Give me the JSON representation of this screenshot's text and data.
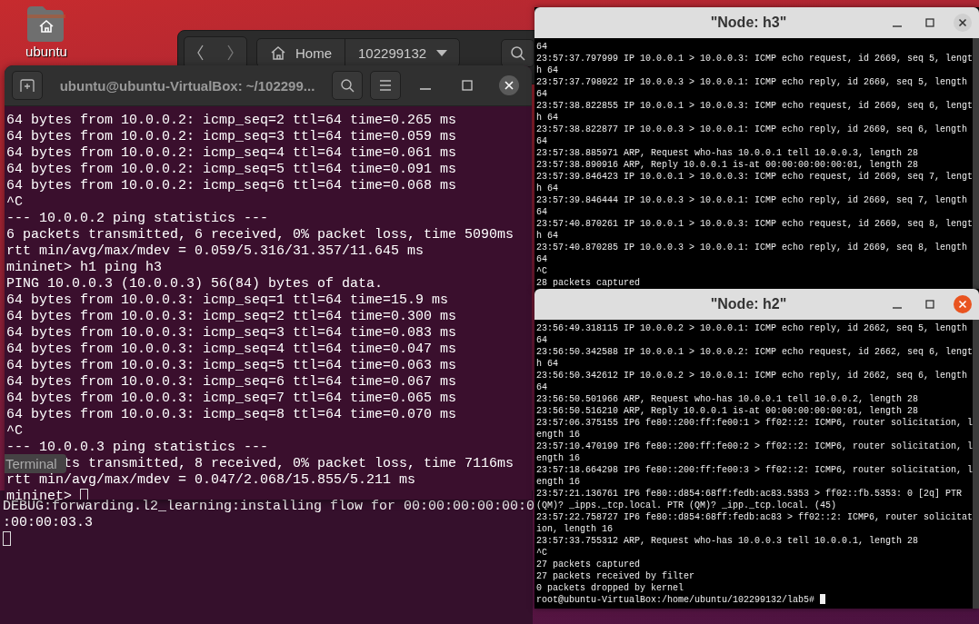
{
  "desktop": {
    "icons": [
      {
        "label": "ubuntu"
      }
    ]
  },
  "file_manager": {
    "path": [
      {
        "label": "Home",
        "kind": "home"
      },
      {
        "label": "102299132",
        "kind": "current"
      }
    ]
  },
  "terminal": {
    "title": "ubuntu@ubuntu-VirtualBox: ~/102299...",
    "lines": [
      {
        "text": "64 bytes from 10.0.0.2: icmp_seq=2 ttl=64 time=0.265 ms"
      },
      {
        "text": "64 bytes from 10.0.0.2: icmp_seq=3 ttl=64 time=0.059 ms"
      },
      {
        "text": "64 bytes from 10.0.0.2: icmp_seq=4 ttl=64 time=0.061 ms"
      },
      {
        "text": "64 bytes from 10.0.0.2: icmp_seq=5 ttl=64 time=0.091 ms"
      },
      {
        "text": "64 bytes from 10.0.0.2: icmp_seq=6 ttl=64 time=0.068 ms"
      },
      {
        "text": "^C"
      },
      {
        "text": "--- 10.0.0.2 ping statistics ---"
      },
      {
        "text": "6 packets transmitted, 6 received, 0% packet loss, time 5090ms"
      },
      {
        "text": "rtt min/avg/max/mdev = 0.059/5.316/31.357/11.645 ms"
      },
      {
        "text": "mininet> h1 ping h3"
      },
      {
        "text": "PING 10.0.0.3 (10.0.0.3) 56(84) bytes of data."
      },
      {
        "text": "64 bytes from 10.0.0.3: icmp_seq=1 ttl=64 time=15.9 ms"
      },
      {
        "text": "64 bytes from 10.0.0.3: icmp_seq=2 ttl=64 time=0.300 ms"
      },
      {
        "text": "64 bytes from 10.0.0.3: icmp_seq=3 ttl=64 time=0.083 ms"
      },
      {
        "text": "64 bytes from 10.0.0.3: icmp_seq=4 ttl=64 time=0.047 ms"
      },
      {
        "text": "64 bytes from 10.0.0.3: icmp_seq=5 ttl=64 time=0.063 ms"
      },
      {
        "text": "64 bytes from 10.0.0.3: icmp_seq=6 ttl=64 time=0.067 ms"
      },
      {
        "text": "64 bytes from 10.0.0.3: icmp_seq=7 ttl=64 time=0.065 ms"
      },
      {
        "text": "64 bytes from 10.0.0.3: icmp_seq=8 ttl=64 time=0.070 ms"
      },
      {
        "text": "^C"
      },
      {
        "text": "--- 10.0.0.3 ping statistics ---"
      },
      {
        "text": "ts transmitted, 8 received, 0% packet loss, time 7116ms",
        "tooltip": "Terminal"
      },
      {
        "text": "rtt min/avg/max/mdev = 0.047/2.068/15.855/5.211 ms"
      },
      {
        "text": "mininet>",
        "cursor": true
      }
    ]
  },
  "background_terminal": {
    "lines": [
      {
        "text": "DEBUG:forwarding.l2_learning:installing flow for 00:00:00:00:00:0"
      },
      {
        "text": ":00:00:03.3"
      },
      {
        "cursor": true
      }
    ]
  },
  "node_windows": [
    {
      "title": "\"Node: h3\"",
      "active": false,
      "lines": [
        "64",
        "23:57:37.797999 IP 10.0.0.1 > 10.0.0.3: ICMP echo request, id 2669, seq 5, length 64",
        "23:57:37.798022 IP 10.0.0.3 > 10.0.0.1: ICMP echo reply, id 2669, seq 5, length 64",
        "23:57:38.822855 IP 10.0.0.1 > 10.0.0.3: ICMP echo request, id 2669, seq 6, length 64",
        "23:57:38.822877 IP 10.0.0.3 > 10.0.0.1: ICMP echo reply, id 2669, seq 6, length 64",
        "23:57:38.885971 ARP, Request who-has 10.0.0.1 tell 10.0.0.3, length 28",
        "23:57:38.890916 ARP, Reply 10.0.0.1 is-at 00:00:00:00:00:01, length 28",
        "23:57:39.846423 IP 10.0.0.1 > 10.0.0.3: ICMP echo request, id 2669, seq 7, length 64",
        "23:57:39.846444 IP 10.0.0.3 > 10.0.0.1: ICMP echo reply, id 2669, seq 7, length 64",
        "23:57:40.870261 IP 10.0.0.1 > 10.0.0.3: ICMP echo request, id 2669, seq 8, length 64",
        "23:57:40.870285 IP 10.0.0.3 > 10.0.0.1: ICMP echo reply, id 2669, seq 8, length 64",
        "^C",
        "28 packets captured"
      ]
    },
    {
      "title": "\"Node: h2\"",
      "active": true,
      "lines": [
        "23:56:49.318115 IP 10.0.0.2 > 10.0.0.1: ICMP echo reply, id 2662, seq 5, length 64",
        "23:56:50.342588 IP 10.0.0.1 > 10.0.0.2: ICMP echo request, id 2662, seq 6, length 64",
        "23:56:50.342612 IP 10.0.0.2 > 10.0.0.1: ICMP echo reply, id 2662, seq 6, length 64",
        "23:56:50.501966 ARP, Request who-has 10.0.0.1 tell 10.0.0.2, length 28",
        "23:56:50.516210 ARP, Reply 10.0.0.1 is-at 00:00:00:00:00:01, length 28",
        "23:57:06.375155 IP6 fe80::200:ff:fe00:1 > ff02::2: ICMP6, router solicitation, length 16",
        "23:57:10.470199 IP6 fe80::200:ff:fe00:2 > ff02::2: ICMP6, router solicitation, length 16",
        "23:57:18.664298 IP6 fe80::200:ff:fe00:3 > ff02::2: ICMP6, router solicitation, length 16",
        "23:57:21.136761 IP6 fe80::d854:68ff:fedb:ac83.5353 > ff02::fb.5353: 0 [2q] PTR (QM)? _ipps._tcp.local. PTR (QM)? _ipp._tcp.local. (45)",
        "23:57:22.758727 IP6 fe80::d854:68ff:fedb:ac83 > ff02::2: ICMP6, router solicitation, length 16",
        "23:57:33.755312 ARP, Request who-has 10.0.0.3 tell 10.0.0.1, length 28",
        "^C",
        "27 packets captured",
        "27 packets received by filter",
        "0 packets dropped by kernel",
        "root@ubuntu-VirtualBox:/home/ubuntu/102299132/lab5# "
      ],
      "cursor": true
    }
  ]
}
